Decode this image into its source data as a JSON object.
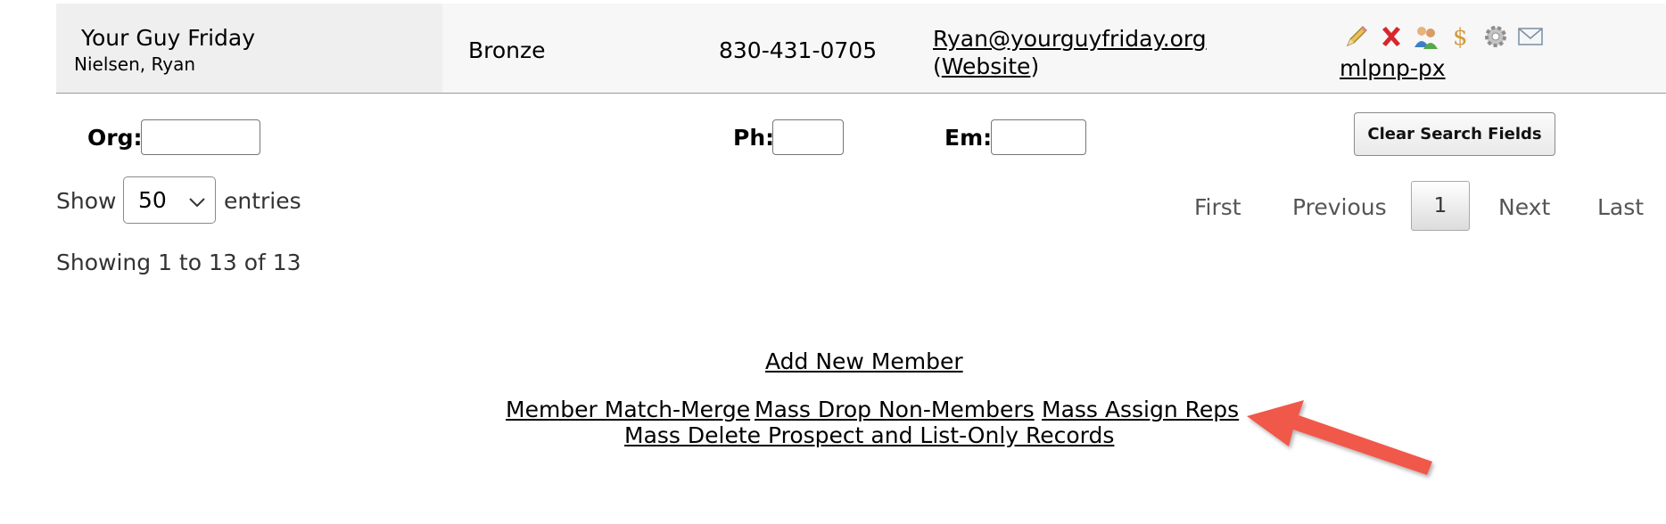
{
  "member_row": {
    "organization": "Your Guy Friday",
    "contact": "Nielsen, Ryan",
    "level": "Bronze",
    "phone": "830-431-0705",
    "email": "Ryan@yourguyfriday.org",
    "website_prefix": "(",
    "website_label": "Website",
    "website_suffix": ")",
    "mlp_link": "mlpnp-px",
    "action_icons": [
      "pencil-edit-icon",
      "red-x-delete-icon",
      "people-reps-icon",
      "dollar-icon",
      "gear-icon",
      "envelope-icon"
    ]
  },
  "search": {
    "org_label": "Org:",
    "phone_label": "Ph:",
    "email_label": "Em:",
    "org_value": "",
    "phone_value": "",
    "email_value": "",
    "clear_button": "Clear Search Fields"
  },
  "table_controls": {
    "show_label": "Show",
    "page_size": "50",
    "entries_label": "entries",
    "info": "Showing 1 to 13 of 13"
  },
  "pagination": {
    "first": "First",
    "previous": "Previous",
    "current": "1",
    "next": "Next",
    "last": "Last"
  },
  "bottom_links": {
    "add_member": "Add New Member",
    "match_merge": "Member Match-Merge",
    "mass_drop": "Mass Drop Non-Members",
    "mass_assign": "Mass Assign Reps",
    "mass_delete": "Mass Delete Prospect and List-Only Records"
  },
  "annotation": {
    "arrow_color": "#f0584a"
  }
}
